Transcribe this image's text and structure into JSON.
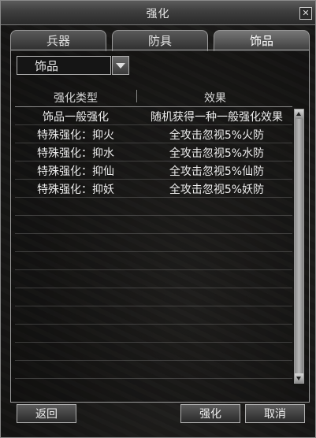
{
  "window": {
    "title": "强化"
  },
  "tabs": [
    {
      "label": "兵器"
    },
    {
      "label": "防具"
    },
    {
      "label": "饰品"
    }
  ],
  "dropdown": {
    "selected": "饰品"
  },
  "table": {
    "headers": [
      "强化类型",
      "效果"
    ],
    "rows": [
      {
        "type": "饰品一般强化",
        "effect": "随机获得一种一般强化效果"
      },
      {
        "type": "特殊强化：抑火",
        "effect": "全攻击忽视5%火防"
      },
      {
        "type": "特殊强化：抑水",
        "effect": "全攻击忽视5%水防"
      },
      {
        "type": "特殊强化：抑仙",
        "effect": "全攻击忽视5%仙防"
      },
      {
        "type": "特殊强化：抑妖",
        "effect": "全攻击忽视5%妖防"
      }
    ]
  },
  "buttons": {
    "back": "返回",
    "enhance": "强化",
    "cancel": "取消"
  },
  "icons": {
    "close": "close-icon",
    "dropdown": "chevron-down-icon"
  }
}
